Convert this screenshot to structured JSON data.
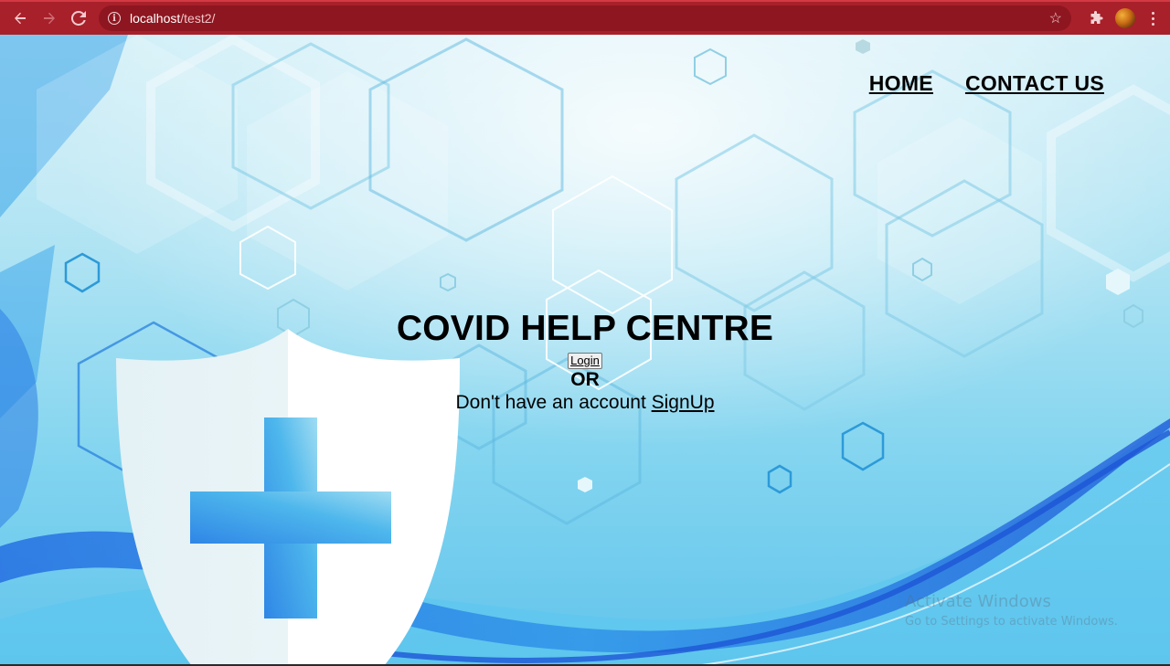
{
  "browser": {
    "url_host": "localhost",
    "url_path": "/test2/",
    "icons": {
      "back": "arrow-left-icon",
      "forward": "arrow-right-icon",
      "reload": "reload-icon",
      "info": "info-icon",
      "bookmark": "star-icon",
      "extensions": "puzzle-icon",
      "profile": "avatar",
      "menu": "more-vert-icon"
    },
    "colors": {
      "toolbar": "#a8202a",
      "address_bar": "#8e1620"
    }
  },
  "nav": {
    "home_label": "HOME",
    "contact_label": "CONTACT US"
  },
  "main": {
    "title": "COVID HELP CENTRE",
    "login_label": "Login",
    "or_label": "OR",
    "signup_prompt": "Don't have an account ",
    "signup_label": "SignUp"
  },
  "watermark": {
    "title": "Activate Windows",
    "subtitle": "Go to Settings to activate Windows."
  },
  "colors": {
    "background_light": "#cfeef7",
    "background_deep": "#1f6fe0",
    "shield": "#eaf4f7",
    "cross": "#3aa0ea"
  }
}
